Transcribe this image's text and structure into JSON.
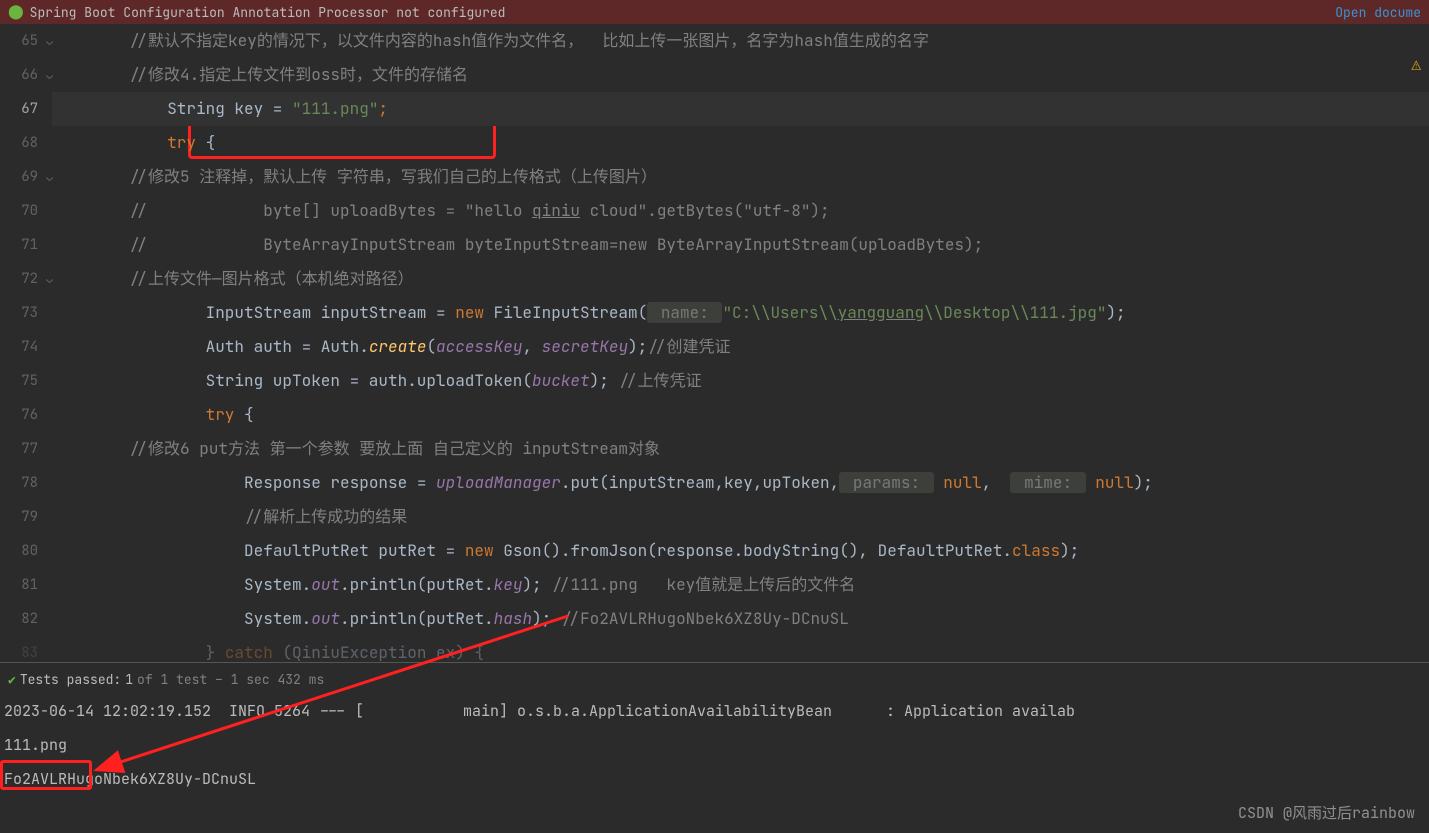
{
  "notification": {
    "message": "Spring Boot Configuration Annotation Processor not configured",
    "link": "Open docume"
  },
  "gutter_start": 65,
  "code": {
    "l65": "//默认不指定key的情况下，以文件内容的hash值作为文件名，  比如上传一张图片，名字为hash值生成的名字",
    "l66": "//修改4.指定上传文件到oss时，文件的存储名",
    "l67_keyword": "String ",
    "l67_var": "key = ",
    "l67_str": "\"111.png\"",
    "l67_semi": ";",
    "l68_try": "try ",
    "l68_brace": "{",
    "l69": "//修改5 注释掉，默认上传 字符串，写我们自己的上传格式（上传图片）",
    "l70_a": "//            byte[] uploadBytes = \"hello ",
    "l70_b": "qiniu",
    "l70_c": " cloud\".getBytes(\"utf-8\");",
    "l71": "//            ByteArrayInputStream byteInputStream=new ByteArrayInputStream(uploadBytes);",
    "l72": "//上传文件—图片格式（本机绝对路径）",
    "l73_a": "InputStream inputStream = ",
    "l73_new": "new ",
    "l73_b": "FileInputStream(",
    "l73_hint": " name: ",
    "l73_str": "\"C:\\\\Users\\\\",
    "l73_under": "yangguang",
    "l73_str2": "\\\\Desktop\\\\111.jpg\"",
    "l73_c": ");",
    "l74_a": "Auth auth = Auth.",
    "l74_m": "create",
    "l74_b": "(",
    "l74_p1": "accessKey",
    "l74_c": ", ",
    "l74_p2": "secretKey",
    "l74_d": ");",
    "l74_comment": "//创建凭证",
    "l75_a": "String upToken = auth.uploadToken(",
    "l75_p": "bucket",
    "l75_b": "); ",
    "l75_comment": "//上传凭证",
    "l76_try": "try ",
    "l76_brace": "{",
    "l77": "//修改6 put方法 第一个参数 要放上面 自己定义的 inputStream对象",
    "l78_a": "Response response = ",
    "l78_p": "uploadManager",
    "l78_b": ".put(inputStream,key,upToken,",
    "l78_hint1": " params: ",
    "l78_null1": "null",
    "l78_c": ",  ",
    "l78_hint2": " mime: ",
    "l78_null2": "null",
    "l78_d": ");",
    "l79": "//解析上传成功的结果",
    "l80_a": "DefaultPutRet putRet = ",
    "l80_new": "new ",
    "l80_b": "Gson().fromJson(response.bodyString(), DefaultPutRet.",
    "l80_class": "class",
    "l80_c": ");",
    "l81_a": "System.",
    "l81_out": "out",
    "l81_b": ".println(putRet.",
    "l81_f": "key",
    "l81_c": "); ",
    "l81_comment": "//111.png   key值就是上传后的文件名",
    "l82_a": "System.",
    "l82_out": "out",
    "l82_b": ".println(pu",
    "l82_mid": "tRet",
    "l82_c": ".",
    "l82_f": "hash",
    "l82_d": "); ",
    "l82_comment": "//Fo2AVLRHugoNbek6XZ8Uy-DCnuSL",
    "l83_a": "} ",
    "l83_catch": "catch ",
    "l83_b": "(QiniuException ex) {"
  },
  "test": {
    "label": "Tests passed:",
    "count": "1",
    "of": "of 1 test – 1 sec 432 ms"
  },
  "console": {
    "line1": "2023-06-14 12:02:19.152  INFO 5264 --- [           main] o.s.b.a.ApplicationAvailabilityBean      : Application availab",
    "line2": "111.png",
    "line3": "Fo2AVLRHugoNbek6XZ8Uy-DCnuSL"
  },
  "watermark": "CSDN @风雨过后rainbow"
}
